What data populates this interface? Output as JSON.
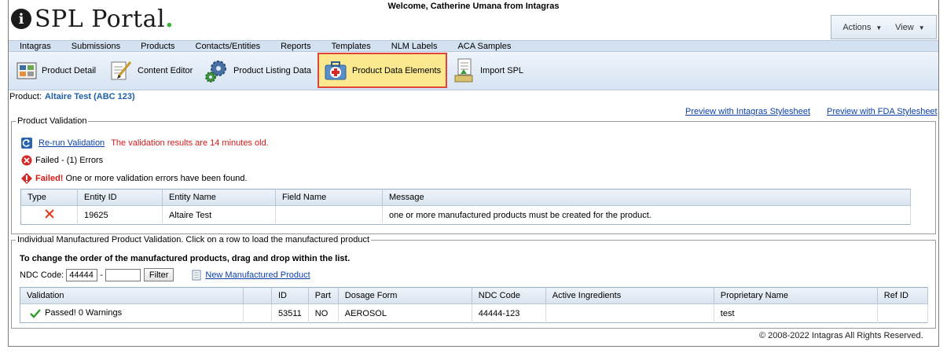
{
  "header": {
    "logo_text": "SPL Portal",
    "logo_dot": ".",
    "logo_badge": "i",
    "welcome": "Welcome, Catherine Umana from Intagras",
    "actions_label": "Actions",
    "view_label": "View"
  },
  "menu": [
    "Intagras",
    "Submissions",
    "Products",
    "Contacts/Entities",
    "Reports",
    "Templates",
    "NLM Labels",
    "ACA Samples"
  ],
  "toolbar": {
    "product_detail": "Product Detail",
    "content_editor": "Content Editor",
    "product_listing_data": "Product Listing Data",
    "product_data_elements": "Product Data Elements",
    "import_spl": "Import SPL"
  },
  "product": {
    "label": "Product:",
    "name": "Altaire Test (ABC 123)"
  },
  "preview": {
    "intagras": "Preview with Intagras Stylesheet",
    "fda": "Preview with FDA Stylesheet"
  },
  "validation": {
    "legend": "Product Validation",
    "rerun_link": "Re-run Validation",
    "age_message": "The validation results are 14 minutes old.",
    "failed_summary": "Failed - (1) Errors",
    "failed_label": "Failed!",
    "failed_message": "One or more validation errors have been found.",
    "columns": [
      "Type",
      "Entity ID",
      "Entity Name",
      "Field Name",
      "Message"
    ],
    "rows": [
      {
        "entity_id": "19625",
        "entity_name": "Altaire Test",
        "field_name": "",
        "message": "one or more manufactured products must be created for the product."
      }
    ]
  },
  "manufactured": {
    "legend": "Individual Manufactured Product Validation. Click on a row to load the manufactured product",
    "instruction": "To change the order of the manufactured products, drag and drop within the list.",
    "ndc_label": "NDC Code:",
    "ndc_value1": "44444",
    "ndc_dash": "-",
    "ndc_value2": "",
    "filter_button": "Filter",
    "new_link": "New Manufactured Product",
    "columns": [
      "Validation",
      "",
      "ID",
      "Part",
      "Dosage Form",
      "NDC Code",
      "Active Ingredients",
      "Proprietary Name",
      "Ref ID"
    ],
    "rows": [
      {
        "validation": "Passed! 0 Warnings",
        "blank": "",
        "id": "53511",
        "part": "NO",
        "dosage_form": "AEROSOL",
        "ndc": "44444-123",
        "active": "",
        "proprietary": "test",
        "ref": ""
      }
    ]
  },
  "footer": "© 2008-2022 Intagras All Rights Reserved."
}
